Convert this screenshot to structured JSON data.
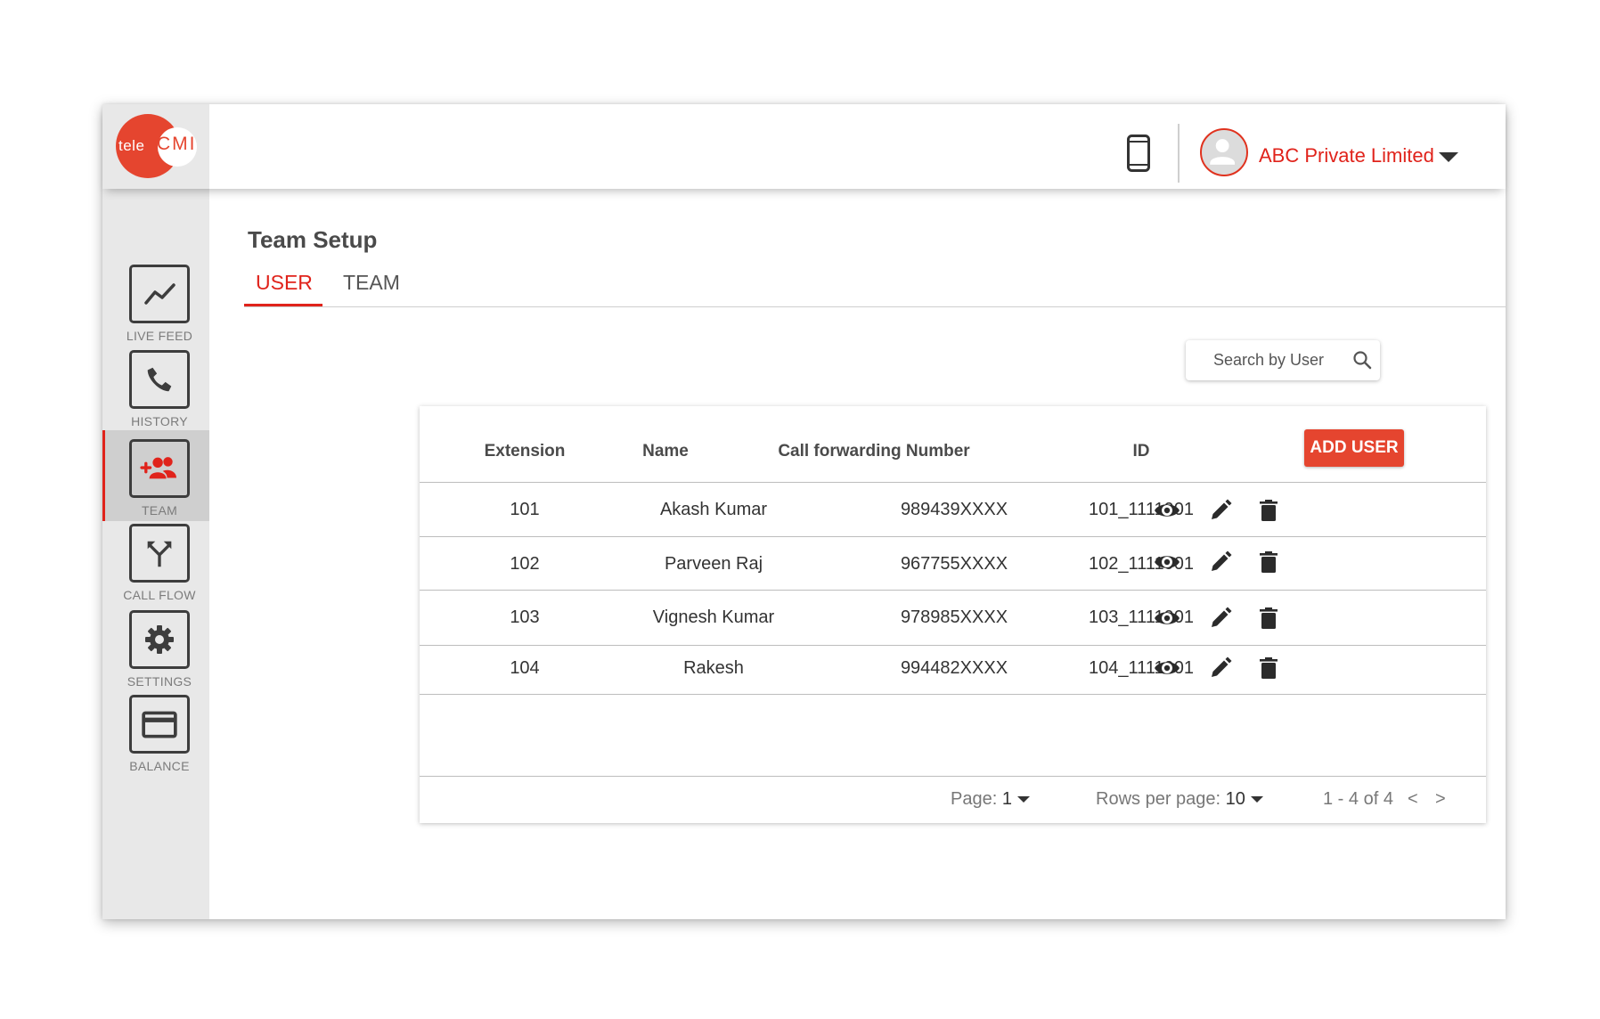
{
  "brand": {
    "logo_left": "tele",
    "logo_right": "CMI",
    "accent": "#e5452f"
  },
  "header": {
    "company_name": "ABC Private Limited",
    "device_icon": "smartphone-icon",
    "avatar_icon": "user-avatar-icon"
  },
  "sidebar": {
    "items": [
      {
        "label": "LIVE FEED",
        "icon": "trend-chart-icon",
        "active": false
      },
      {
        "label": "HISTORY",
        "icon": "phone-icon",
        "active": false
      },
      {
        "label": "TEAM",
        "icon": "add-group-icon",
        "active": true
      },
      {
        "label": "CALL FLOW",
        "icon": "split-arrow-icon",
        "active": false
      },
      {
        "label": "SETTINGS",
        "icon": "gear-icon",
        "active": false
      },
      {
        "label": "BALANCE",
        "icon": "card-icon",
        "active": false
      }
    ]
  },
  "page": {
    "title": "Team Setup"
  },
  "tabs": [
    {
      "label": "USER",
      "active": true
    },
    {
      "label": "TEAM",
      "active": false
    }
  ],
  "search": {
    "placeholder": "Search by User"
  },
  "table": {
    "columns": [
      "Extension",
      "Name",
      "Call forwarding Number",
      "ID"
    ],
    "add_button": "ADD USER",
    "rows": [
      {
        "extension": "101",
        "name": "Akash Kumar",
        "forward": "989439XXXX",
        "id": "101_1111901"
      },
      {
        "extension": "102",
        "name": "Parveen Raj",
        "forward": "967755XXXX",
        "id": "102_1111901"
      },
      {
        "extension": "103",
        "name": "Vignesh Kumar",
        "forward": "978985XXXX",
        "id": "103_1111901"
      },
      {
        "extension": "104",
        "name": "Rakesh",
        "forward": "994482XXXX",
        "id": "104_1111901"
      }
    ],
    "row_actions": [
      "view-icon",
      "edit-icon",
      "delete-icon"
    ]
  },
  "pagination": {
    "page_label": "Page:",
    "page_value": "1",
    "rows_label": "Rows per page:",
    "rows_value": "10",
    "range": "1 - 4 of 4",
    "prev": "<",
    "next": ">"
  }
}
